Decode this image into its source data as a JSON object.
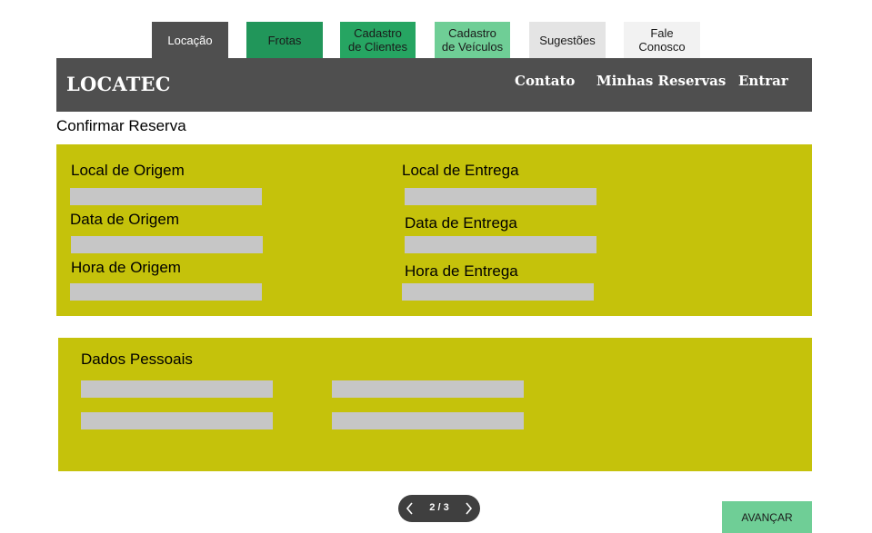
{
  "tabs": [
    {
      "label": "Locação",
      "bg": "#4f4f4f",
      "fg": "#ffffff"
    },
    {
      "label": "Frotas",
      "bg": "#21965a",
      "fg": "#1a1a1a"
    },
    {
      "label": "Cadastro\nde Clientes",
      "bg": "#26a562",
      "fg": "#1a1a1a"
    },
    {
      "label": "Cadastro\nde Veículos",
      "bg": "#6fce96",
      "fg": "#1a1a1a"
    },
    {
      "label": "Sugestões",
      "bg": "#e4e4e4",
      "fg": "#1a1a1a"
    },
    {
      "label": "Fale\nConosco",
      "bg": "#f2f2f2",
      "fg": "#1a1a1a"
    }
  ],
  "header": {
    "logo": "LOCATEC",
    "nav": [
      "Contato",
      "Minhas Reservas",
      "Entrar"
    ]
  },
  "page_title": "Confirmar Reserva",
  "reservation": {
    "labels": [
      "Local de Origem",
      "Data de Origem",
      "Hora de Origem",
      "Local de Entrega",
      "Data de Entrega",
      "Hora de Entrega"
    ]
  },
  "personal": {
    "title": "Dados Pessoais"
  },
  "pager": {
    "text": "2 / 3"
  },
  "advance_label": "AVANÇAR",
  "colors": {
    "panel": "#c5c20b",
    "field": "#c6c6c6",
    "header": "#4f4f4f",
    "advance": "#6fce96"
  }
}
